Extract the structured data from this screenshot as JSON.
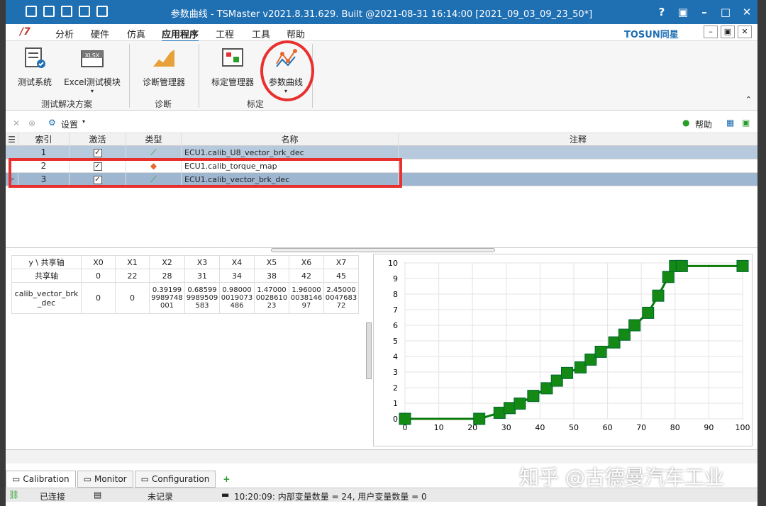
{
  "window": {
    "title": "参数曲线 - TSMaster v2021.8.31.629. Built @2021-08-31 16:14:00 [2021_09_03_09_23_50*]",
    "help": "?",
    "min": "–",
    "max": "□",
    "close": "✕",
    "restore": "▣"
  },
  "menu": {
    "items": [
      "分析",
      "硬件",
      "仿真",
      "应用程序",
      "工程",
      "工具",
      "帮助"
    ],
    "active": "应用程序",
    "brand": "TOSUN同星"
  },
  "ribbon": {
    "buttons": [
      "测试系统",
      "Excel测试模块",
      "诊断管理器",
      "标定管理器",
      "参数曲线"
    ],
    "excel_badge": "XLSX",
    "groups": [
      "测试解决方案",
      "诊断",
      "标定"
    ]
  },
  "toolbar": {
    "settings": "设置",
    "help": "帮助"
  },
  "grid": {
    "headers": [
      "索引",
      "激活",
      "类型",
      "名称",
      "注释"
    ],
    "rows": [
      {
        "index": "1",
        "name": "ECU1.calib_U8_vector_brk_dec"
      },
      {
        "index": "2",
        "name": "ECU1.calib_torque_map"
      },
      {
        "index": "3",
        "name": "ECU1.calib_vector_brk_dec"
      }
    ]
  },
  "table": {
    "corner": "y \\ 共享轴",
    "shared_label": "共享轴",
    "row_label": "calib_vector_brk_dec",
    "cols": [
      "X0",
      "X1",
      "X2",
      "X3",
      "X4",
      "X5",
      "X6",
      "X7"
    ],
    "shared": [
      "0",
      "22",
      "28",
      "31",
      "34",
      "38",
      "42",
      "45"
    ],
    "values": [
      "0",
      "0",
      "0.39199 9989748 001",
      "0.68599 9989509 583",
      "0.98000 0019073 486",
      "1.47000 0028610 23",
      "1.96000 0038146 97",
      "2.45000 0047683 72"
    ]
  },
  "chart_data": {
    "type": "line",
    "x": [
      0,
      22,
      28,
      31,
      34,
      38,
      42,
      45,
      48,
      52,
      55,
      58,
      62,
      65,
      68,
      72,
      75,
      78,
      80,
      82,
      100
    ],
    "y": [
      0,
      0,
      0.39,
      0.69,
      0.98,
      1.47,
      1.96,
      2.45,
      2.94,
      3.3,
      3.8,
      4.3,
      4.9,
      5.4,
      6.0,
      6.8,
      7.9,
      9.1,
      9.8,
      9.8,
      9.8
    ],
    "xlim": [
      0,
      100
    ],
    "ylim": [
      0,
      10
    ],
    "xticks": [
      "0",
      "10",
      "20",
      "30",
      "40",
      "50",
      "60",
      "70",
      "80",
      "90",
      "100"
    ],
    "yticks": [
      "0",
      "1",
      "2",
      "3",
      "4",
      "5",
      "6",
      "7",
      "8",
      "9",
      "10"
    ],
    "color": "#0a7a0a"
  },
  "tabs": [
    "Calibration",
    "Monitor",
    "Configuration"
  ],
  "status": {
    "connected": "已连接",
    "record": "未记录",
    "message": "10:20:09: 内部变量数量 = 24, 用户变量数量 = 0"
  },
  "watermark": "知乎 @古德曼汽车工业"
}
